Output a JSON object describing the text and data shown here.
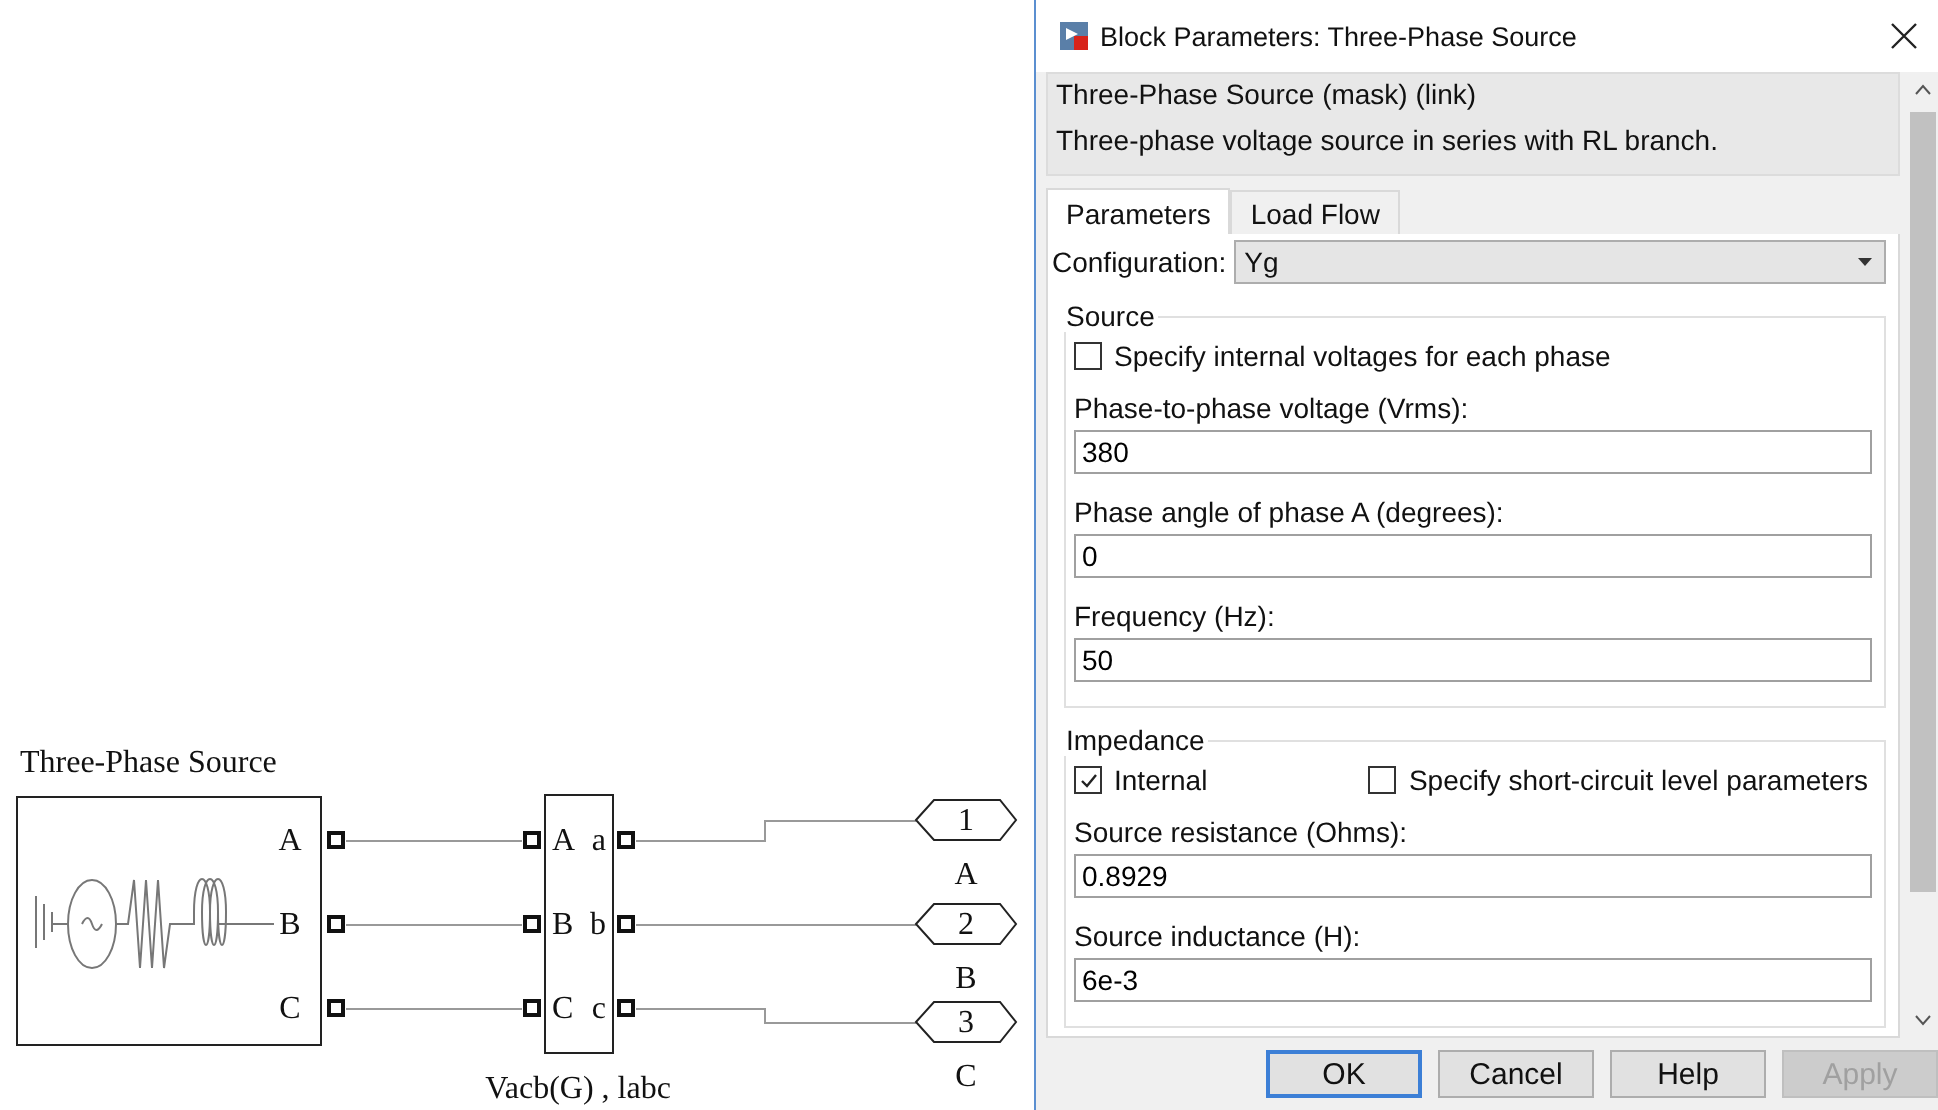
{
  "diagram": {
    "source_block": {
      "title": "Three-Phase Source",
      "ports": [
        "A",
        "B",
        "C"
      ]
    },
    "measurement_block": {
      "label": "Vacb(G) , labc",
      "ports": [
        {
          "input": "A",
          "output": "a"
        },
        {
          "input": "B",
          "output": "b"
        },
        {
          "input": "C",
          "output": "c"
        }
      ]
    },
    "outports": [
      {
        "number": "1",
        "label": "A"
      },
      {
        "number": "2",
        "label": "B"
      },
      {
        "number": "3",
        "label": "C"
      }
    ]
  },
  "dialog": {
    "title": "Block Parameters: Three-Phase Source",
    "mask_title": "Three-Phase Source (mask) (link)",
    "description": "Three-phase voltage source in series with RL branch.",
    "tabs": [
      {
        "label": "Parameters",
        "selected": true
      },
      {
        "label": "Load Flow",
        "selected": false
      }
    ],
    "configuration": {
      "label": "Configuration:",
      "value": "Yg"
    },
    "groups": [
      {
        "title": "Source",
        "items": [
          {
            "kind": "checkbox",
            "label": "Specify internal voltages for each phase",
            "checked": false
          },
          {
            "kind": "field",
            "label": "Phase-to-phase voltage (Vrms):",
            "value": "380"
          },
          {
            "kind": "field",
            "label": "Phase angle of phase A (degrees):",
            "value": "0"
          },
          {
            "kind": "field",
            "label": "Frequency (Hz):",
            "value": "50"
          }
        ]
      },
      {
        "title": "Impedance",
        "items": [
          {
            "kind": "checkbox_row",
            "checkboxes": [
              {
                "label": "Internal",
                "checked": true
              },
              {
                "label": "Specify short-circuit level parameters",
                "checked": false
              }
            ]
          },
          {
            "kind": "field",
            "label": "Source resistance (Ohms):",
            "value": "0.8929"
          },
          {
            "kind": "field",
            "label": "Source inductance (H):",
            "value": "6e-3"
          }
        ]
      }
    ],
    "buttons": [
      {
        "label": "OK",
        "default": true,
        "disabled": false
      },
      {
        "label": "Cancel",
        "default": false,
        "disabled": false
      },
      {
        "label": "Help",
        "default": false,
        "disabled": false
      },
      {
        "label": "Apply",
        "default": false,
        "disabled": true
      }
    ]
  }
}
